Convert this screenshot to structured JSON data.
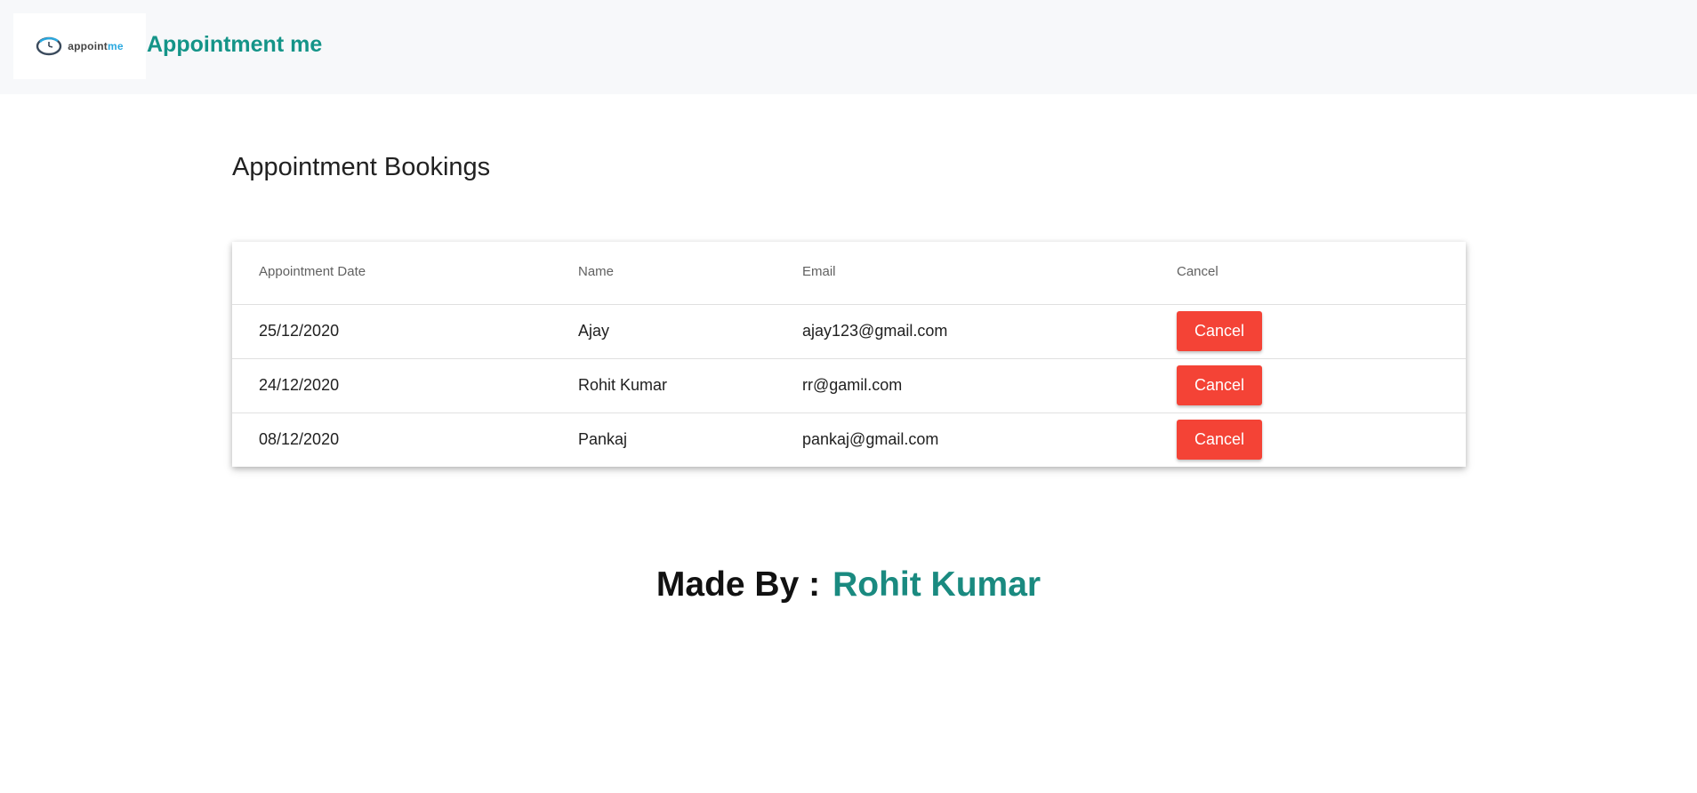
{
  "header": {
    "logo_text_main": "appoint",
    "logo_text_accent": "me",
    "brand_title": "Appointment me",
    "brand_color": "#149488"
  },
  "page": {
    "title": "Appointment Bookings"
  },
  "table": {
    "columns": [
      "Appointment Date",
      "Name",
      "Email",
      "Cancel"
    ],
    "rows": [
      {
        "date": "25/12/2020",
        "name": "Ajay",
        "email": "ajay123@gmail.com",
        "action_label": "Cancel"
      },
      {
        "date": "24/12/2020",
        "name": "Rohit Kumar",
        "email": "rr@gamil.com",
        "action_label": "Cancel"
      },
      {
        "date": "08/12/2020",
        "name": "Pankaj",
        "email": "pankaj@gmail.com",
        "action_label": "Cancel"
      }
    ],
    "cancel_button_color": "#f44336"
  },
  "footer": {
    "made_by_label": "Made By :",
    "author": "Rohit Kumar",
    "author_color": "#1a8a80"
  }
}
